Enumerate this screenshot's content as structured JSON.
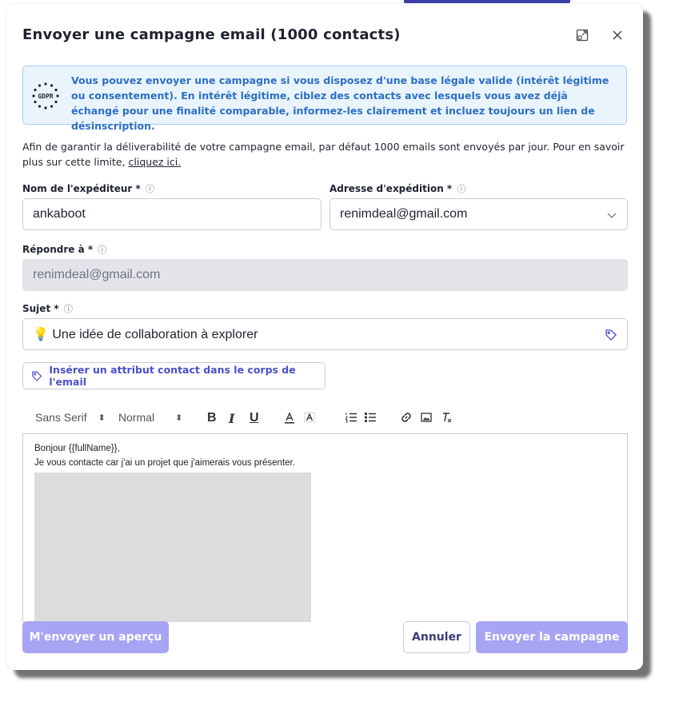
{
  "dialog": {
    "title": "Envoyer une campagne email (1000 contacts)"
  },
  "gdpr": {
    "logo_text": "GDPR",
    "text": "Vous pouvez envoyer une campagne si vous disposez d'une base légale valide (intérêt légitime ou consentement). En intérêt légitime, ciblez des contacts avec lesquels vous avez déjà échangé pour une finalité comparable, informez-les clairement et incluez toujours un lien de désinscription."
  },
  "info": {
    "text": "Afin de garantir la déliverabilité de votre campagne email, par défaut 1000 emails sont envoyés par jour. Pour en savoir plus sur cette limite, ",
    "link": "cliquez ici."
  },
  "form": {
    "sender_name_label": "Nom de l'expéditeur *",
    "sender_name_value": "ankaboot",
    "sender_address_label": "Adresse d'expédition *",
    "sender_address_value": "renimdeal@gmail.com",
    "reply_to_label": "Répondre à *",
    "reply_to_value": "renimdeal@gmail.com",
    "subject_label": "Sujet *",
    "subject_value": "💡 Une idée de collaboration à explorer",
    "info_glyph": "ⓘ"
  },
  "insert_attribute_label": "Insérer un attribut contact dans le corps de l'email",
  "toolbar": {
    "font": "Sans Serif",
    "size": "Normal",
    "bold": "B",
    "italic": "I",
    "underline": "U"
  },
  "editor": {
    "line1": "Bonjour {{fullName}},",
    "line2": "Je vous contacte car j'ai un projet que j'aimerais vous présenter."
  },
  "actions": {
    "preview": "M'envoyer un aperçu",
    "cancel": "Annuler",
    "send": "Envoyer la campagne"
  },
  "colors": {
    "accent": "#4a50c9",
    "primary_disabled": "#a7a4f3",
    "gdpr_bg": "#eaf4fd",
    "gdpr_text": "#2d6fc4"
  }
}
